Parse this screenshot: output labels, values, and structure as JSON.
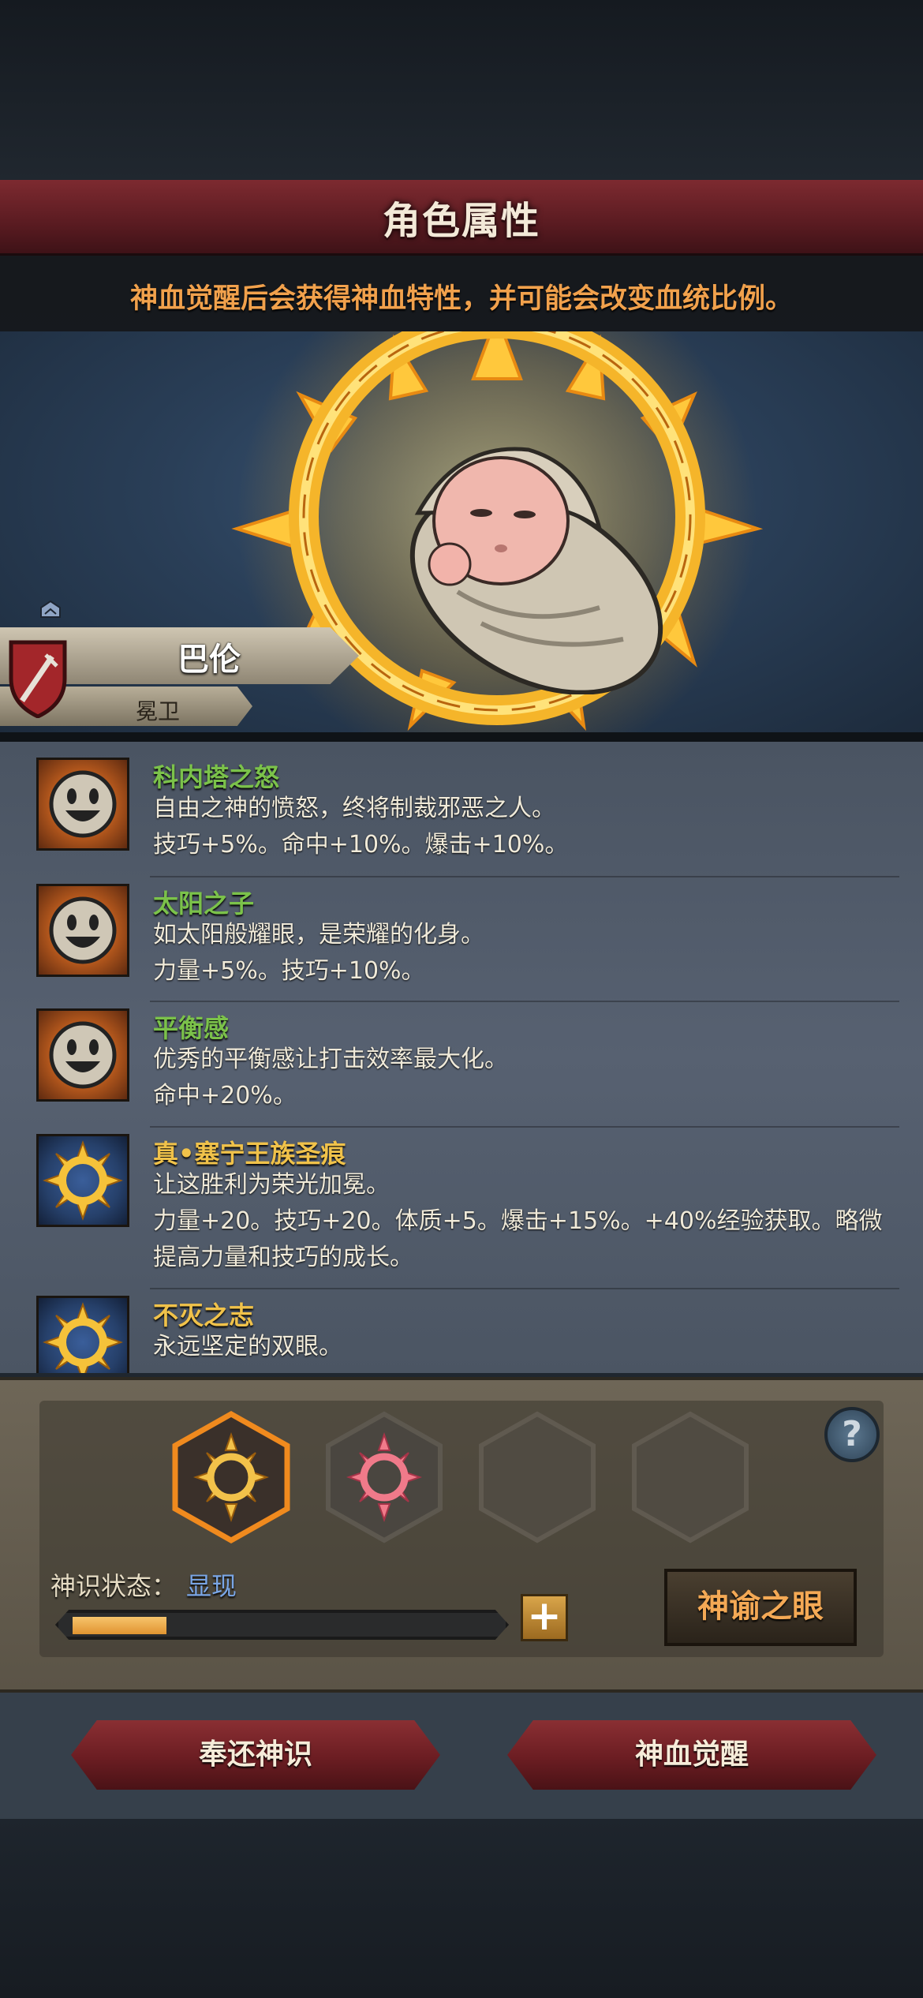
{
  "header": {
    "title": "角色属性",
    "hint": "神血觉醒后会获得神血特性，并可能会改变血统比例。"
  },
  "character": {
    "name": "巴伦",
    "class": "冕卫"
  },
  "traits": [
    {
      "name": "科内塔之怒",
      "name_color": "#7bc24a",
      "icon": "smiley-icon",
      "desc1": "自由之神的愤怒，终将制裁邪恶之人。",
      "desc2": "技巧+5%。命中+10%。爆击+10%。"
    },
    {
      "name": "太阳之子",
      "name_color": "#7bc24a",
      "icon": "smiley-icon",
      "desc1": "如太阳般耀眼，是荣耀的化身。",
      "desc2": "力量+5%。技巧+10%。"
    },
    {
      "name": "平衡感",
      "name_color": "#7bc24a",
      "icon": "smiley-icon",
      "desc1": "优秀的平衡感让打击效率最大化。",
      "desc2": "命中+20%。"
    },
    {
      "name": "真•塞宁王族圣痕",
      "name_color": "#f0c24a",
      "icon": "sun-sigil-icon",
      "desc1": "让这胜利为荣光加冕。",
      "desc2": "力量+20。技巧+20。体质+5。爆击+15%。+40%经验获取。略微",
      "desc3": "提高力量和技巧的成长。"
    },
    {
      "name": "不灭之志",
      "name_color": "#f0c24a",
      "icon": "sun-sigil-icon",
      "desc1": "永远坚定的双眼。"
    }
  ],
  "oracle": {
    "state_label": "神识状态：",
    "state_value": "显现",
    "progress": 0.22,
    "eye_button": "神谕之眼",
    "help": "?",
    "plus": "+"
  },
  "actions": {
    "return_label": "奉还神识",
    "awaken_label": "神血觉醒"
  },
  "colors": {
    "accent_orange": "#f1a14c",
    "trait_green": "#7bc24a",
    "trait_gold": "#f0c24a",
    "state_blue": "#7aa6e6",
    "banner_red": "#7d2a30"
  }
}
